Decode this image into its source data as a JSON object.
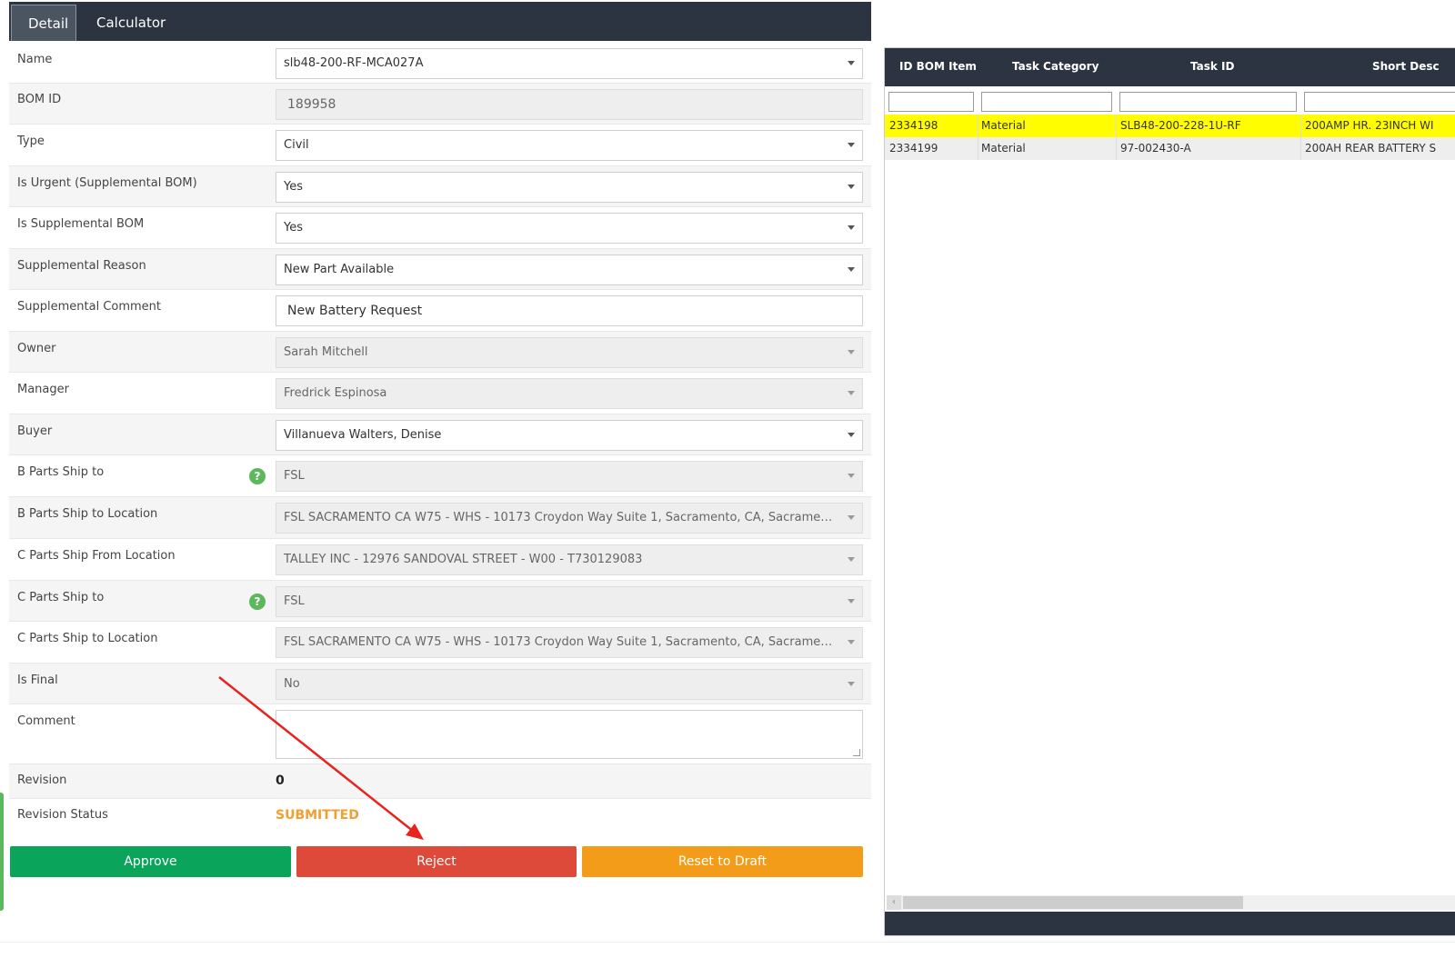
{
  "tabs": [
    {
      "label": "Detail",
      "active": true
    },
    {
      "label": "Calculator",
      "active": false
    }
  ],
  "form": {
    "name": {
      "label": "Name",
      "value": "slb48-200-RF-MCA027A"
    },
    "bom_id": {
      "label": "BOM ID",
      "value": "189958"
    },
    "type": {
      "label": "Type",
      "value": "Civil"
    },
    "is_urgent": {
      "label": "Is Urgent (Supplemental BOM)",
      "value": "Yes"
    },
    "is_supplemental": {
      "label": "Is Supplemental BOM",
      "value": "Yes"
    },
    "supplemental_reason": {
      "label": "Supplemental Reason",
      "value": "New Part Available"
    },
    "supplemental_comment": {
      "label": "Supplemental Comment",
      "value": "New Battery Request"
    },
    "owner": {
      "label": "Owner",
      "value": "Sarah Mitchell"
    },
    "manager": {
      "label": "Manager",
      "value": "Fredrick Espinosa"
    },
    "buyer": {
      "label": "Buyer",
      "value": "Villanueva Walters, Denise"
    },
    "b_parts_ship_to": {
      "label": "B Parts Ship to",
      "value": "FSL"
    },
    "b_parts_ship_to_location": {
      "label": "B Parts Ship to Location",
      "value": "FSL SACRAMENTO CA W75 - WHS - 10173 Croydon Way Suite 1, Sacramento, CA, Sacramento - W7..."
    },
    "c_parts_ship_from_location": {
      "label": "C Parts Ship From Location",
      "value": "TALLEY INC - 12976 SANDOVAL STREET - W00 - T730129083"
    },
    "c_parts_ship_to": {
      "label": "C Parts Ship to",
      "value": "FSL"
    },
    "c_parts_ship_to_location": {
      "label": "C Parts Ship to Location",
      "value": "FSL SACRAMENTO CA W75 - WHS - 10173 Croydon Way Suite 1, Sacramento, CA, Sacramento - W7..."
    },
    "is_final": {
      "label": "Is Final",
      "value": "No"
    },
    "comment": {
      "label": "Comment",
      "value": ""
    },
    "revision": {
      "label": "Revision",
      "value": "0"
    },
    "revision_status": {
      "label": "Revision Status",
      "value": "SUBMITTED"
    },
    "help_icon_glyph": "?"
  },
  "buttons": {
    "approve": "Approve",
    "reject": "Reject",
    "reset": "Reset to Draft"
  },
  "grid": {
    "columns": [
      "ID BOM Item",
      "Task Category",
      "Task ID",
      "Short Desc"
    ],
    "rows": [
      {
        "id": "2334198",
        "category": "Material",
        "task_id": "SLB48-200-228-1U-RF",
        "desc": "200AMP HR. 23INCH WI"
      },
      {
        "id": "2334199",
        "category": "Material",
        "task_id": "97-002430-A",
        "desc": "200AH REAR BATTERY S"
      }
    ]
  },
  "colors": {
    "header_dark": "#2b3440",
    "approve": "#0aa45a",
    "reject": "#de4a3a",
    "reset": "#f39c1a",
    "status_submitted": "#f0a030",
    "row_highlight": "#fffd00",
    "annotation_arrow": "#e8231f"
  },
  "icons": {
    "dropdown": "chevron-down-icon",
    "help": "question-circle-icon",
    "scroll_left": "chevron-left-icon",
    "annotation": "red-arrow-annotation"
  }
}
